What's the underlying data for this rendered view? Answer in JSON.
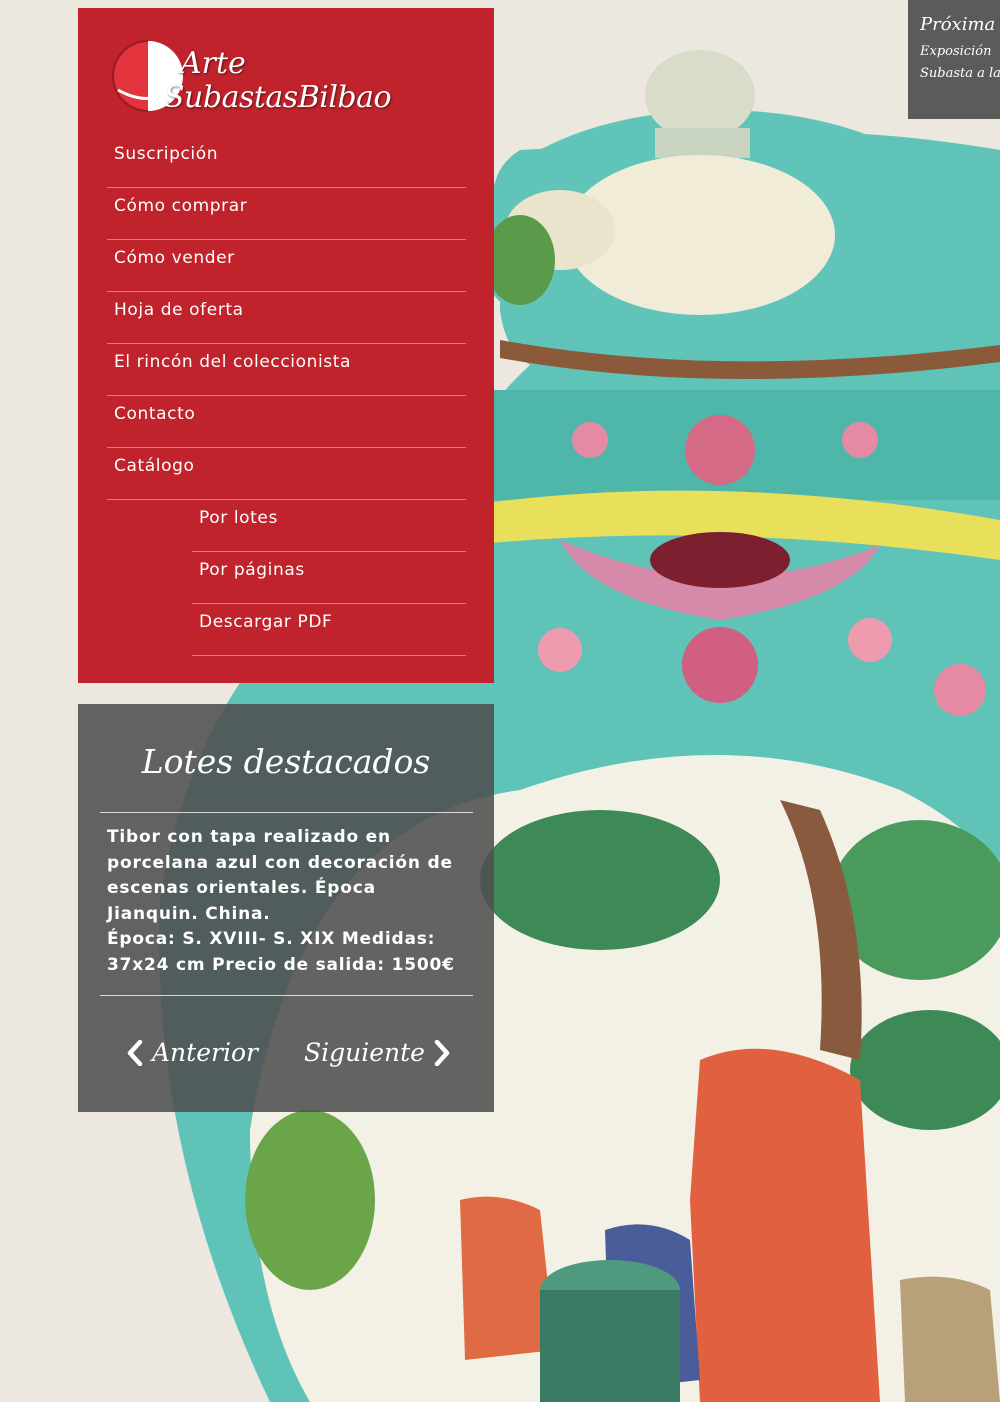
{
  "brand": {
    "line1": "Arte",
    "line2": "SubastasBilbao",
    "color": "#c1232c"
  },
  "nav": {
    "items": [
      {
        "label": "Suscripción"
      },
      {
        "label": "Cómo comprar"
      },
      {
        "label": "Cómo vender"
      },
      {
        "label": "Hoja de oferta"
      },
      {
        "label": "El rincón del coleccionista"
      },
      {
        "label": "Contacto"
      },
      {
        "label": "Catálogo"
      },
      {
        "label": "Por lotes"
      },
      {
        "label": "Por páginas"
      },
      {
        "label": "Descargar PDF"
      }
    ]
  },
  "featured": {
    "title": "Lotes destacados",
    "description_lines": [
      "Tibor con tapa realizado en",
      "porcelana azul con decoración de",
      "escenas orientales. Época",
      "Jianquin. China.",
      "Época: S. XVIII- S. XIX Medidas:",
      "37x24 cm Precio de salida: 1500€"
    ],
    "prev_label": "Anterior",
    "next_label": "Siguiente"
  },
  "upcoming": {
    "title": "Próxima",
    "line1": "Exposición",
    "line2": "Subasta a la"
  },
  "icons": {
    "prev": "chevron-left-icon",
    "next": "chevron-right-icon",
    "logo": "half-circle-logo-icon"
  }
}
